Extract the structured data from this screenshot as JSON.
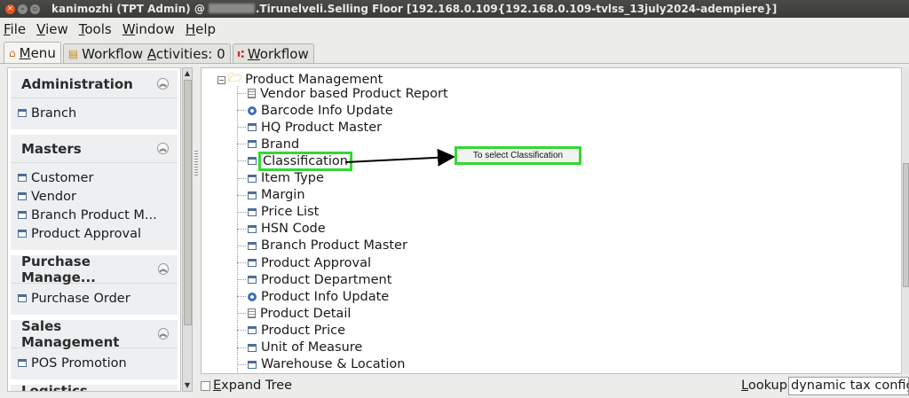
{
  "window": {
    "title_prefix": "kanimozhi (TPT Admin) @",
    "title_suffix": ".Tirunelveli.Selling Floor [192.168.0.109{192.168.0.109-tvlss_13july2024-adempiere}]"
  },
  "menubar": [
    {
      "label": "File",
      "ul": "F",
      "rest": "ile"
    },
    {
      "label": "View",
      "ul": "V",
      "rest": "iew"
    },
    {
      "label": "Tools",
      "ul": "T",
      "rest": "ools"
    },
    {
      "label": "Window",
      "ul": "W",
      "rest": "indow"
    },
    {
      "label": "Help",
      "ul": "H",
      "rest": "elp"
    }
  ],
  "tabs": {
    "menu": "Menu",
    "workflow_activities": "Workflow Activities: 0",
    "workflow": "Workflow"
  },
  "sidebar": {
    "groups": [
      {
        "title": "Administration",
        "items": [
          "Branch"
        ]
      },
      {
        "title": "Masters",
        "items": [
          "Customer",
          "Vendor",
          "Branch Product M...",
          "Product Approval"
        ]
      },
      {
        "title": "Purchase Manage...",
        "items": [
          "Purchase Order"
        ]
      },
      {
        "title": "Sales Management",
        "items": [
          "POS Promotion"
        ]
      },
      {
        "title": "Logistics Manage...",
        "items": []
      }
    ]
  },
  "tree": {
    "root": "Product Management",
    "nodes": [
      {
        "label": "Vendor based Product Report",
        "icon": "report-icon"
      },
      {
        "label": "Barcode Info Update",
        "icon": "process-icon"
      },
      {
        "label": "HQ Product Master",
        "icon": "window-icon"
      },
      {
        "label": "Brand",
        "icon": "window-icon"
      },
      {
        "label": "Classification",
        "icon": "window-icon"
      },
      {
        "label": "Item Type",
        "icon": "window-icon"
      },
      {
        "label": "Margin",
        "icon": "window-icon"
      },
      {
        "label": "Price List",
        "icon": "window-icon"
      },
      {
        "label": "HSN Code",
        "icon": "window-icon"
      },
      {
        "label": "Branch Product Master",
        "icon": "window-icon"
      },
      {
        "label": "Product Approval",
        "icon": "window-icon"
      },
      {
        "label": "Product Department",
        "icon": "window-icon"
      },
      {
        "label": "Product Info Update",
        "icon": "process-icon"
      },
      {
        "label": "Product Detail",
        "icon": "report-icon"
      },
      {
        "label": "Product Price",
        "icon": "window-icon"
      },
      {
        "label": "Unit of Measure",
        "icon": "window-icon"
      },
      {
        "label": "Warehouse & Location",
        "icon": "window-icon"
      }
    ],
    "highlighted": "Classification"
  },
  "annotation": {
    "callout": "To select Classification",
    "highlight_color": "#35d635"
  },
  "bottom": {
    "expand_tree": "Expand Tree",
    "lookup_label": "Lookup",
    "lookup_value": "dynamic tax config"
  }
}
